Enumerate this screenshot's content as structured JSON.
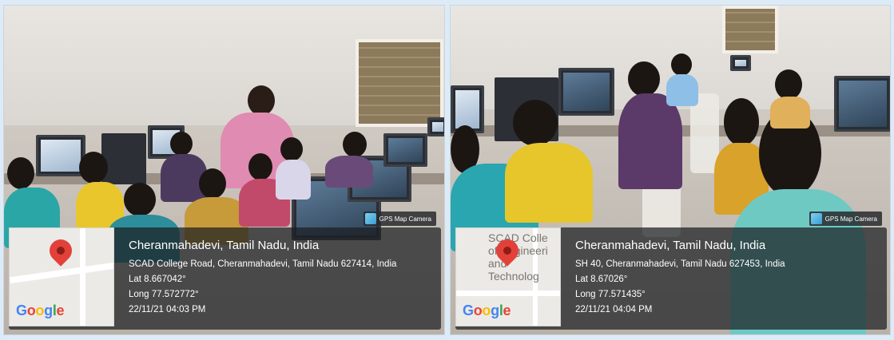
{
  "photos": [
    {
      "map_text": "",
      "google_label": [
        "G",
        "o",
        "o",
        "g",
        "l",
        "e"
      ],
      "badge": "GPS Map Camera",
      "city": "Cheranmahadevi, Tamil Nadu, India",
      "address": "SCAD College Road, Cheranmahadevi, Tamil Nadu 627414, India",
      "lat": "Lat 8.667042°",
      "long": "Long 77.572772°",
      "timestamp": "22/11/21 04:03 PM"
    },
    {
      "map_text": "SCAD Colle\nof Engineeri\nand\nTechnolog",
      "google_label": [
        "G",
        "o",
        "o",
        "g",
        "l",
        "e"
      ],
      "badge": "GPS Map Camera",
      "city": "Cheranmahadevi, Tamil Nadu, India",
      "address": "SH 40, Cheranmahadevi, Tamil Nadu 627453, India",
      "lat": "Lat 8.67026°",
      "long": "Long 77.571435°",
      "timestamp": "22/11/21 04:04 PM"
    }
  ],
  "colors": {
    "background": "#dcebf6",
    "overlay": "#1c1e22",
    "pin": "#e2413a"
  },
  "icons": [
    "map-pin-icon",
    "gps-camera-icon"
  ]
}
